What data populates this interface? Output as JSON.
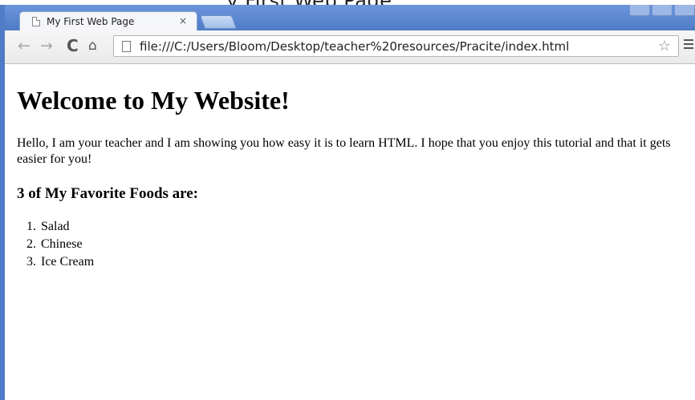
{
  "caption": {
    "text": "...y First Web Page"
  },
  "browser": {
    "tab": {
      "title": "My First Web Page",
      "close": "×"
    },
    "toolbar": {
      "back": "←",
      "forward": "→",
      "reload": "C",
      "home": "⌂",
      "url": "file:///C:/Users/Bloom/Desktop/teacher%20resources/Pracite/index.html",
      "star": "☆"
    },
    "accent_color": "#4f7cc6"
  },
  "page": {
    "heading": "Welcome to My Website!",
    "paragraph": "Hello, I am your teacher and I am showing you how easy it is to learn HTML. I hope that you enjoy this tutorial and that it gets easier for you!",
    "subheading": "3 of My Favorite Foods are:",
    "foods": [
      {
        "num": "1.",
        "label": "Salad"
      },
      {
        "num": "2.",
        "label": "Chinese"
      },
      {
        "num": "3.",
        "label": "Ice Cream"
      }
    ]
  }
}
